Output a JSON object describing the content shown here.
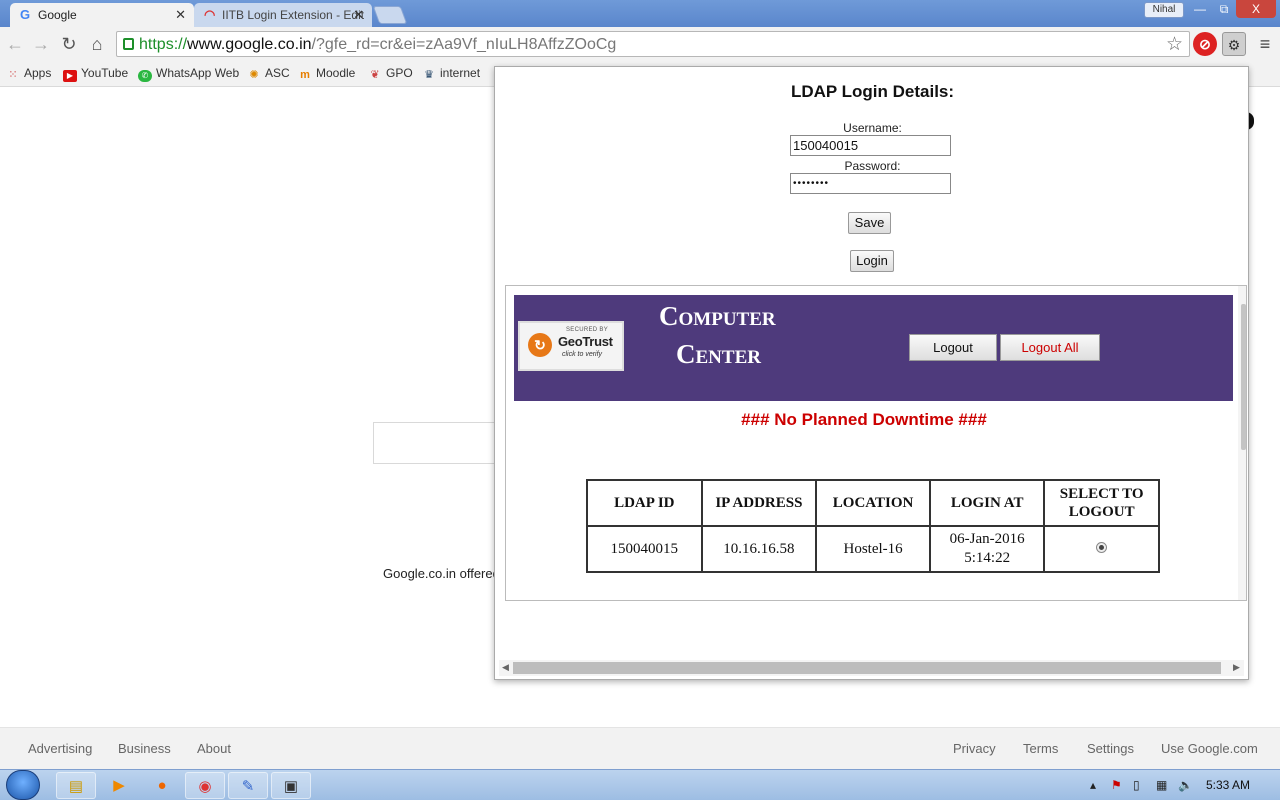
{
  "browser": {
    "tabs": [
      {
        "label": "Google",
        "icon": "G"
      },
      {
        "label": "IITB Login Extension - Edit"
      }
    ],
    "profile_name": "Nihal",
    "window_buttons": {
      "minimize": "—",
      "restore": "⧉",
      "close": "X"
    },
    "url": {
      "scheme": "https://",
      "host": "www.google.co.in",
      "path": "/?gfe_rd=cr&ei=zAa9Vf_nIuLH8AffzZOoCg"
    },
    "bookmarks": [
      "Apps",
      "YouTube",
      "WhatsApp Web",
      "ASC",
      "Moodle",
      "GPO",
      "internet"
    ]
  },
  "google": {
    "offered_text": "Google.co.in offered",
    "footer_left": [
      "Advertising",
      "Business",
      "About"
    ],
    "footer_right": [
      "Privacy",
      "Terms",
      "Settings",
      "Use Google.com"
    ]
  },
  "popup": {
    "title": "LDAP Login Details:",
    "username_label": "Username:",
    "username_value": "150040015",
    "password_label": "Password:",
    "password_value": "••••••••",
    "save_label": "Save",
    "login_label": "Login",
    "frame": {
      "geotrust": {
        "secured": "SECURED BY",
        "name": "GeoTrust",
        "verify": "click to verify"
      },
      "center_line1": "Computer",
      "center_line2": "Center",
      "logout_label": "Logout",
      "logout_all_label": "Logout All",
      "downtime": "### No Planned Downtime ###",
      "table": {
        "headers": [
          "LDAP ID",
          "IP ADDRESS",
          "LOCATION",
          "LOGIN AT",
          "SELECT TO LOGOUT"
        ],
        "rows": [
          {
            "ldap_id": "150040015",
            "ip": "10.16.16.58",
            "location": "Hostel-16",
            "login_date": "06-Jan-2016",
            "login_time": "5:14:22"
          }
        ]
      }
    }
  },
  "taskbar": {
    "clock": "5:33 AM"
  },
  "colors": {
    "banner": "#4e3a7c",
    "downtime": "#cc0000",
    "logout_all_text": "#cc0000",
    "url_scheme": "#1d8f2a"
  }
}
